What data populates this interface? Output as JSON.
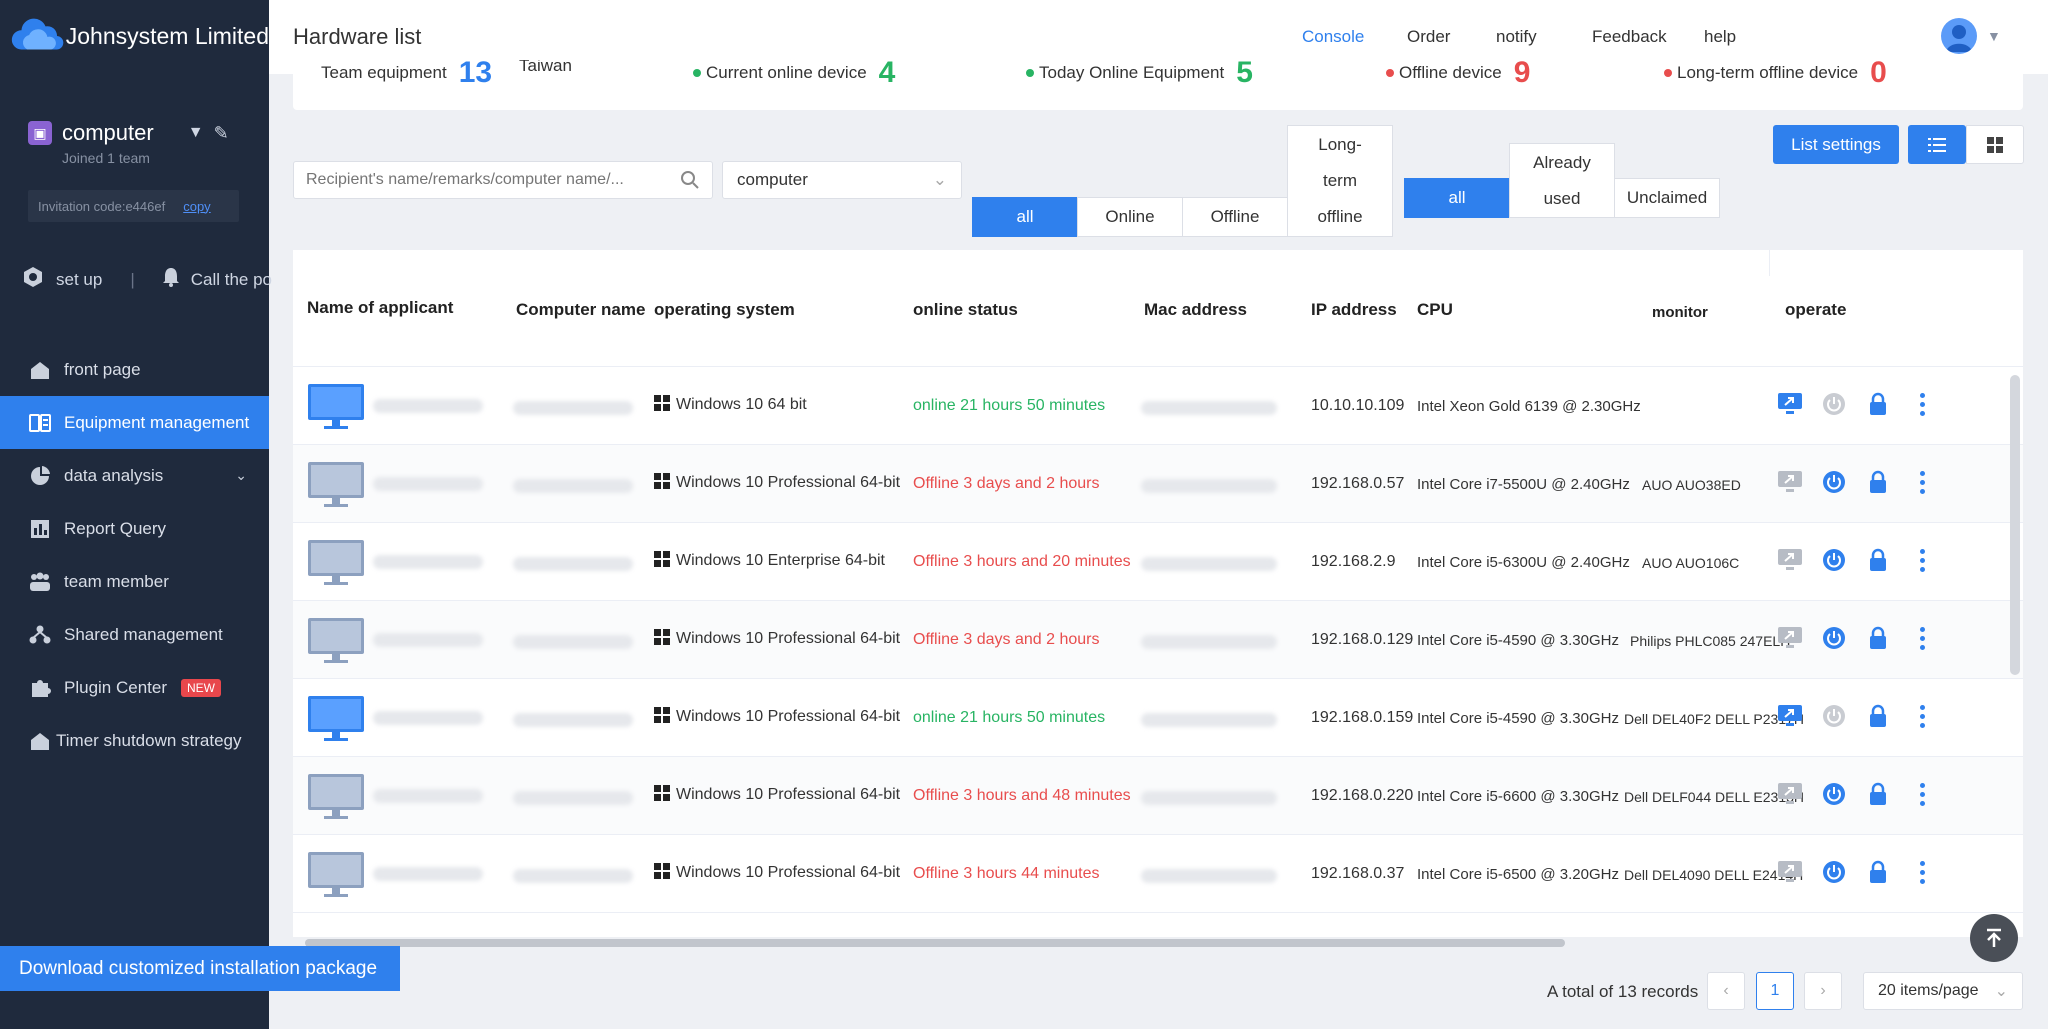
{
  "brand": {
    "name": "Johnsystem Limited"
  },
  "team": {
    "name": "computer",
    "joined": "Joined 1 team",
    "invite_label": "Invitation code:e446ef",
    "copy_label": "copy"
  },
  "sidebar_top": {
    "setup": "set up",
    "call": "Call the po"
  },
  "nav": [
    {
      "label": "front page",
      "icon": "home-icon"
    },
    {
      "label": "Equipment management",
      "icon": "equipment-icon",
      "active": true
    },
    {
      "label": "data analysis",
      "icon": "pie-chart-icon"
    },
    {
      "label": "Report Query",
      "icon": "report-icon"
    },
    {
      "label": "team member",
      "icon": "team-icon"
    },
    {
      "label": "Shared management",
      "icon": "share-icon"
    },
    {
      "label": "Plugin Center",
      "icon": "plugin-icon",
      "badge": "NEW"
    },
    {
      "label": "Timer shutdown strategy",
      "icon": "timer-icon"
    }
  ],
  "download_label": "Download customized installation package",
  "header": {
    "title": "Hardware list",
    "links": [
      "Console",
      "Order",
      "notify",
      "Feedback",
      "help"
    ]
  },
  "stats": [
    {
      "label": "Team equipment",
      "value": "13",
      "color": "#2f80ed"
    },
    {
      "label": "Taiwan",
      "value": "",
      "color": ""
    },
    {
      "label": "Current online device",
      "value": "4",
      "color": "#28b463"
    },
    {
      "label": "Today Online Equipment",
      "value": "5",
      "color": "#28b463"
    },
    {
      "label": "Offline device",
      "value": "9",
      "color": "#e84d4d"
    },
    {
      "label": "Long-term offline device",
      "value": "0",
      "color": "#e84d4d"
    }
  ],
  "filters": {
    "search_placeholder": "Recipient's name/remarks/computer name/...",
    "team_select": "computer",
    "status_tabs": [
      "all",
      "Online",
      "Offline",
      "Long-term offline"
    ],
    "claim_tabs": [
      "all",
      "Already used",
      "Unclaimed"
    ],
    "list_settings": "List settings"
  },
  "table": {
    "columns": [
      "Name of applicant",
      "Computer name",
      "operating system",
      "online status",
      "Mac address",
      "IP address",
      "CPU",
      "monitor",
      "operate"
    ],
    "rows": [
      {
        "os": "Windows 10 64 bit",
        "status": "online 21 hours 50 minutes",
        "online": true,
        "ip": "10.10.10.109",
        "cpu": "Intel Xeon Gold 6139 @ 2.30GHz",
        "monitor": ""
      },
      {
        "os": "Windows 10 Professional 64-bit",
        "status": "Offline 3 days and 2 hours",
        "online": false,
        "ip": "192.168.0.57",
        "cpu": "Intel Core i7-5500U @ 2.40GHz",
        "monitor": "AUO AUO38ED"
      },
      {
        "os": "Windows 10 Enterprise 64-bit",
        "status": "Offline 3 hours and 20 minutes",
        "online": false,
        "ip": "192.168.2.9",
        "cpu": "Intel Core i5-6300U @ 2.40GHz",
        "monitor": "AUO AUO106C"
      },
      {
        "os": "Windows 10 Professional 64-bit",
        "status": "Offline 3 days and 2 hours",
        "online": false,
        "ip": "192.168.0.129",
        "cpu": "Intel Core i5-4590 @ 3.30GHz",
        "monitor": "Philips PHLC085 247ELH"
      },
      {
        "os": "Windows 10 Professional 64-bit",
        "status": "online 21 hours 50 minutes",
        "online": true,
        "ip": "192.168.0.159",
        "cpu": "Intel Core i5-4590 @ 3.30GHz",
        "monitor": "Dell DEL40F2 DELL P2317H"
      },
      {
        "os": "Windows 10 Professional 64-bit",
        "status": "Offline 3 hours and 48 minutes",
        "online": false,
        "ip": "192.168.0.220",
        "cpu": "Intel Core i5-6600 @ 3.30GHz",
        "monitor": "Dell DELF044 DELL E2313H"
      },
      {
        "os": "Windows 10 Professional 64-bit",
        "status": "Offline 3 hours 44 minutes",
        "online": false,
        "ip": "192.168.0.37",
        "cpu": "Intel Core i5-6500 @ 3.20GHz",
        "monitor": "Dell DEL4090 DELL E2414H"
      }
    ]
  },
  "pagination": {
    "total": "A total of 13 records",
    "page": "1",
    "page_size": "20 items/page"
  }
}
